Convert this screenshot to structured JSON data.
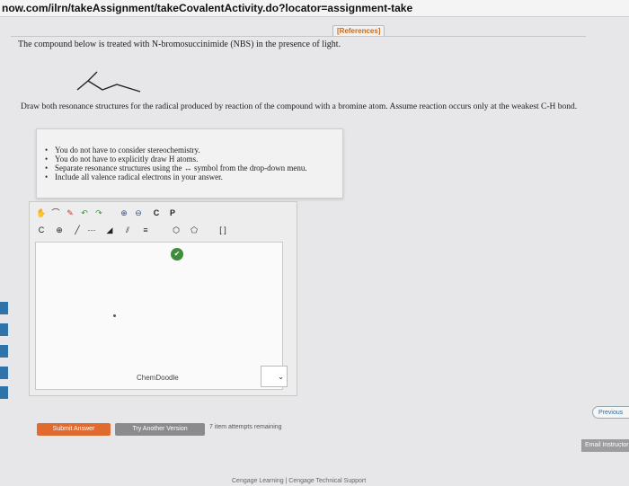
{
  "browser": {
    "url": "now.com/ilrn/takeAssignment/takeCovalentActivity.do?locator=assignment-take"
  },
  "references_label": "[References]",
  "question": {
    "intro": "The compound below is treated with N-bromosuccinimide (NBS) in the presence of light.",
    "instruction": "Draw both resonance structures for the radical produced by reaction of the compound with a bromine atom. Assume reaction occurs only at the weakest C-H bond.",
    "hints": [
      "You do not have to consider stereochemistry.",
      "You do not have to explicitly draw H atoms.",
      "Separate resonance structures using the ↔ symbol from the drop-down menu.",
      "Include all valence radical electrons in your answer."
    ]
  },
  "editor": {
    "toolbar_row1": [
      {
        "icon": "hand-icon",
        "glyph": "✋"
      },
      {
        "icon": "lasso-icon",
        "glyph": "⌒"
      },
      {
        "icon": "eraser-icon",
        "glyph": "✎"
      },
      {
        "icon": "undo-icon",
        "glyph": "↶"
      },
      {
        "icon": "redo-icon",
        "glyph": "↷"
      },
      {
        "icon": "zoom-in-icon",
        "glyph": "⊕"
      },
      {
        "icon": "zoom-out-icon",
        "glyph": "⊖"
      },
      {
        "icon": "copy-icon",
        "glyph": "C"
      },
      {
        "icon": "paste-icon",
        "glyph": "P"
      }
    ],
    "toolbar_row2": [
      {
        "icon": "carbon-atom-icon",
        "glyph": "C"
      },
      {
        "icon": "charge-plus-icon",
        "glyph": "⊕"
      },
      {
        "icon": "single-bond-icon",
        "glyph": "╱"
      },
      {
        "icon": "chain-icon",
        "glyph": "⋯"
      },
      {
        "icon": "wedge-bond-icon",
        "glyph": "◢"
      },
      {
        "icon": "double-bond-icon",
        "glyph": "⫽"
      },
      {
        "icon": "triple-bond-icon",
        "glyph": "≡"
      },
      {
        "icon": "ring-hexagon-icon",
        "glyph": "⬡"
      },
      {
        "icon": "ring-pentagon-icon",
        "glyph": "⬠"
      },
      {
        "icon": "brackets-icon",
        "glyph": "[ ]"
      }
    ],
    "brand": "ChemDoodle",
    "arrow_select": "⌄"
  },
  "buttons": {
    "submit": "Submit Answer",
    "another": "Try Another Version",
    "attempts": "7 item attempts remaining"
  },
  "sidebar": {
    "previous": "Previous",
    "email": "Email Instructor"
  },
  "footer": "Cengage Learning | Cengage Technical Support"
}
